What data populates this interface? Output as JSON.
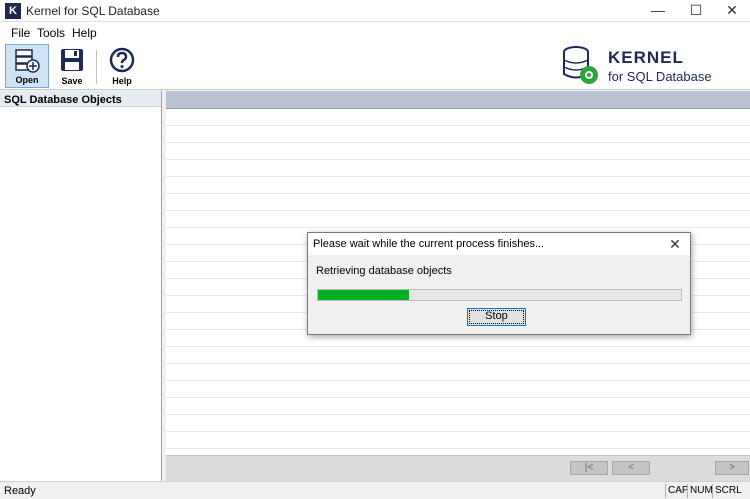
{
  "window": {
    "title": "Kernel for SQL Database",
    "icon_letter": "K"
  },
  "menu": {
    "items": [
      "File",
      "Tools",
      "Help"
    ]
  },
  "toolbar": {
    "open_label": "Open",
    "save_label": "Save",
    "help_label": "Help"
  },
  "brand": {
    "name": "KERNEL",
    "subtitle": "for SQL Database"
  },
  "left_panel": {
    "header": "SQL Database Objects"
  },
  "pager": {
    "first": "|<",
    "prev": "<",
    "next": ">"
  },
  "status": {
    "text": "Ready",
    "indicators": [
      "CAP",
      "NUM",
      "SCRL"
    ]
  },
  "dialog": {
    "title": "Please wait while the current process finishes...",
    "message": "Retrieving database objects",
    "progress_fraction": 0.25,
    "stop_label": "Stop"
  },
  "colors": {
    "progress": "#06b025",
    "brand": "#1c2a54",
    "focus": "#0078d7"
  }
}
